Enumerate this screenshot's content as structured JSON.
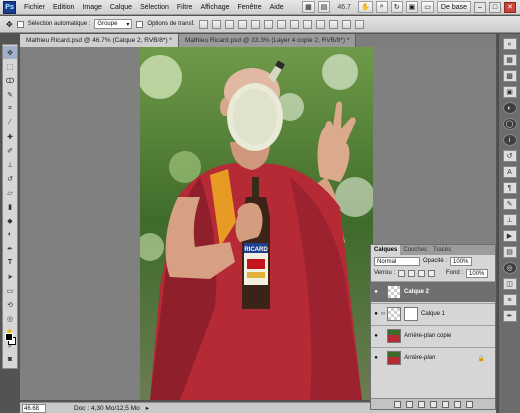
{
  "app": {
    "logo": "Ps"
  },
  "menu": [
    "Fichier",
    "Edition",
    "Image",
    "Calque",
    "Sélection",
    "Filtre",
    "Affichage",
    "Fenêtre",
    "Aide"
  ],
  "menu_right": {
    "zoom": "46.7",
    "workspace": "De base"
  },
  "options": {
    "auto_select_label": "Sélection automatique :",
    "auto_select_value": "Groupe",
    "transform_label": "Options de transf."
  },
  "tabs": [
    {
      "label": "Mathieu Ricard.psd @ 46.7% (Calque 2, RVB/8*) *",
      "active": true
    },
    {
      "label": "Mathieu Ricard.psd @ 33.3% (Layer 4 copie 2, RVB/8*) *",
      "active": false
    }
  ],
  "status": {
    "zoom": "46.68 %",
    "doc": "Doc : 4,30 Mo/12,5 Mo"
  },
  "layers_panel": {
    "tabs": [
      "Calques",
      "Couches",
      "Tracés"
    ],
    "blend_mode": "Normal",
    "opacity_label": "Opacité :",
    "opacity_value": "100%",
    "lock_label": "Verrou :",
    "fill_label": "Fond :",
    "fill_value": "100%",
    "layers": [
      {
        "name": "Calque 2",
        "selected": true
      },
      {
        "name": "Calque 1",
        "selected": false
      },
      {
        "name": "Arrière-plan copie",
        "selected": false
      },
      {
        "name": "Arrière-plan",
        "selected": false
      }
    ]
  },
  "bottle_label": "RICARD",
  "colors": {
    "robe": "#b52a35",
    "accent": "#e79a24",
    "foliage": "#3f6b2a"
  }
}
